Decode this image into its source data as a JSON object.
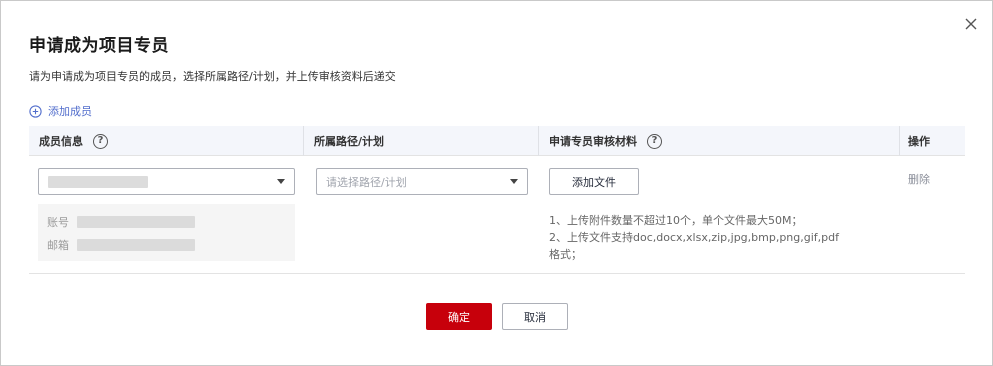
{
  "dialog": {
    "title": "申请成为项目专员",
    "description": "请为申请成为项目专员的成员，选择所属路径/计划，并上传审核资料后递交",
    "close_icon": "close-icon"
  },
  "add_member": {
    "label": "添加成员",
    "icon": "plus-circle-icon"
  },
  "table": {
    "headers": [
      "成员信息",
      "所属路径/计划",
      "申请专员审核材料",
      "操作"
    ],
    "help_icon": "question-circle-icon",
    "row": {
      "member_info": {
        "account_label": "账号",
        "email_label": "邮箱"
      },
      "path_select": {
        "placeholder": "请选择路径/计划"
      },
      "upload_button": "添加文件",
      "hints": [
        "1、上传附件数量不超过10个，单个文件最大50M；",
        "2、上传文件支持doc,docx,xlsx,zip,jpg,bmp,png,gif,pdf",
        "格式；"
      ],
      "delete_label": "删除"
    }
  },
  "footer": {
    "confirm_label": "确定",
    "cancel_label": "取消"
  },
  "colors": {
    "primary": "#c7000b",
    "link": "#526ecc",
    "header_bg": "#f4f6fb"
  }
}
